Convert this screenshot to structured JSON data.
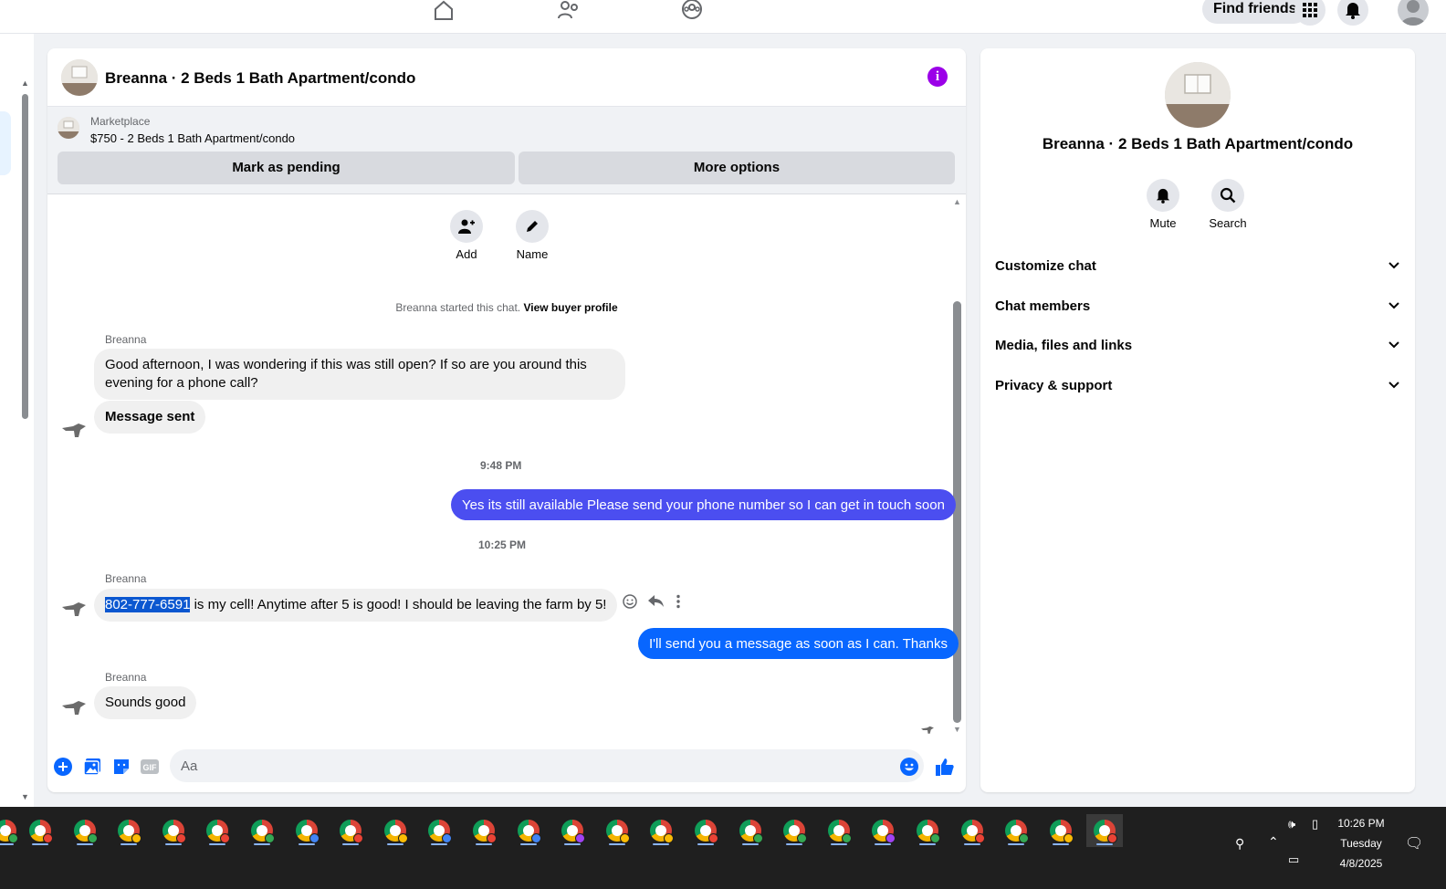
{
  "topbar": {
    "find_friends_label": "Find friends"
  },
  "chat": {
    "title": "Breanna · 2 Beds 1 Bath Apartment/condo",
    "marketplace_label": "Marketplace",
    "listing": "$750 - 2 Beds 1 Bath Apartment/condo",
    "mark_pending_label": "Mark as pending",
    "more_options_label": "More options",
    "add_label": "Add",
    "name_label": "Name",
    "started_text": "Breanna started this chat.",
    "view_profile_link": "View buyer profile",
    "messages": [
      {
        "sender": "Breanna",
        "text": "Good afternoon, I was wondering if this was still open? If so are you around this evening for a phone call?"
      },
      {
        "text": "Message sent"
      },
      {
        "time": "9:48 PM"
      },
      {
        "text": "Yes its still available Please send your phone number so I can get in touch soon"
      },
      {
        "time": "10:25 PM"
      },
      {
        "sender": "Breanna",
        "highlight": "802-777-6591",
        "text": " is my cell! Anytime after 5 is good! I should be leaving the farm by 5!"
      },
      {
        "text": "I'll send you a message as soon as I can. Thanks"
      },
      {
        "sender": "Breanna",
        "text": "Sounds good"
      }
    ],
    "composer_placeholder": "Aa"
  },
  "details": {
    "title": "Breanna · 2 Beds 1 Bath Apartment/condo",
    "mute_label": "Mute",
    "search_label": "Search",
    "sections": [
      "Customize chat",
      "Chat members",
      "Media, files and links",
      "Privacy & support"
    ]
  },
  "taskbar": {
    "app_count": 26,
    "time": "10:26 PM",
    "day": "Tuesday",
    "date": "4/8/2025"
  },
  "colors": {
    "accent": "#0866ff",
    "outgoing_purple": "#4b4ef0",
    "info_purple": "#9b00e8",
    "selection": "#0b57d0"
  }
}
